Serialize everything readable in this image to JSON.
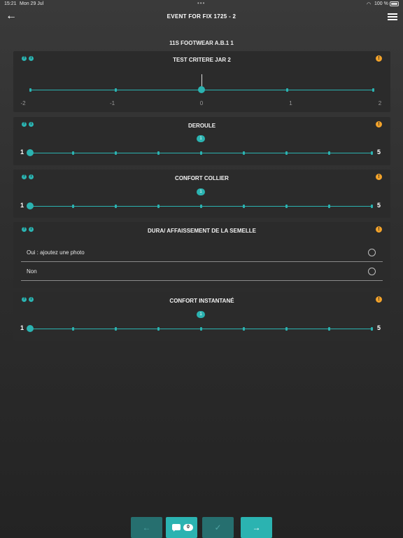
{
  "statusbar": {
    "time": "15:21",
    "date": "Mon 29 Jul",
    "battery": "100 %",
    "dots": "•••"
  },
  "nav": {
    "title": "EVENT FOR FIX 1725 - 2",
    "back_glyph": "←"
  },
  "subtitle": "11S FOOTWEAR A.B.1 1",
  "info_icons": {
    "help": "?",
    "info": "i",
    "warning": "!"
  },
  "cards": [
    {
      "title": "TEST CRITERE JAR 2",
      "type": "slider",
      "min": -2,
      "max": 2,
      "value": 0,
      "labels": [
        "-2",
        "-1",
        "0",
        "1",
        "2"
      ]
    },
    {
      "title": "DEROULE",
      "type": "slider",
      "min": 1,
      "max": 5,
      "value": 1,
      "min_label": "1",
      "max_label": "5",
      "value_label": "1"
    },
    {
      "title": "CONFORT COLLIER",
      "type": "slider",
      "min": 1,
      "max": 5,
      "value": 1,
      "min_label": "1",
      "max_label": "5",
      "value_label": "1"
    },
    {
      "title": "DURA/ AFFAISSEMENT DE LA SEMELLE",
      "type": "choice",
      "options": [
        "Oui : ajoutez une photo",
        "Non"
      ]
    },
    {
      "title": "CONFORT INSTANTANÉ",
      "type": "slider",
      "min": 1,
      "max": 5,
      "value": 1,
      "min_label": "1",
      "max_label": "5",
      "value_label": "1"
    }
  ],
  "bottombar": {
    "prev_glyph": "←",
    "comment_count": "0",
    "check_glyph": "✓",
    "next_glyph": "→"
  },
  "colors": {
    "accent": "#2bb3b1",
    "warning": "#f2a22a",
    "card": "#2b2b2b"
  }
}
